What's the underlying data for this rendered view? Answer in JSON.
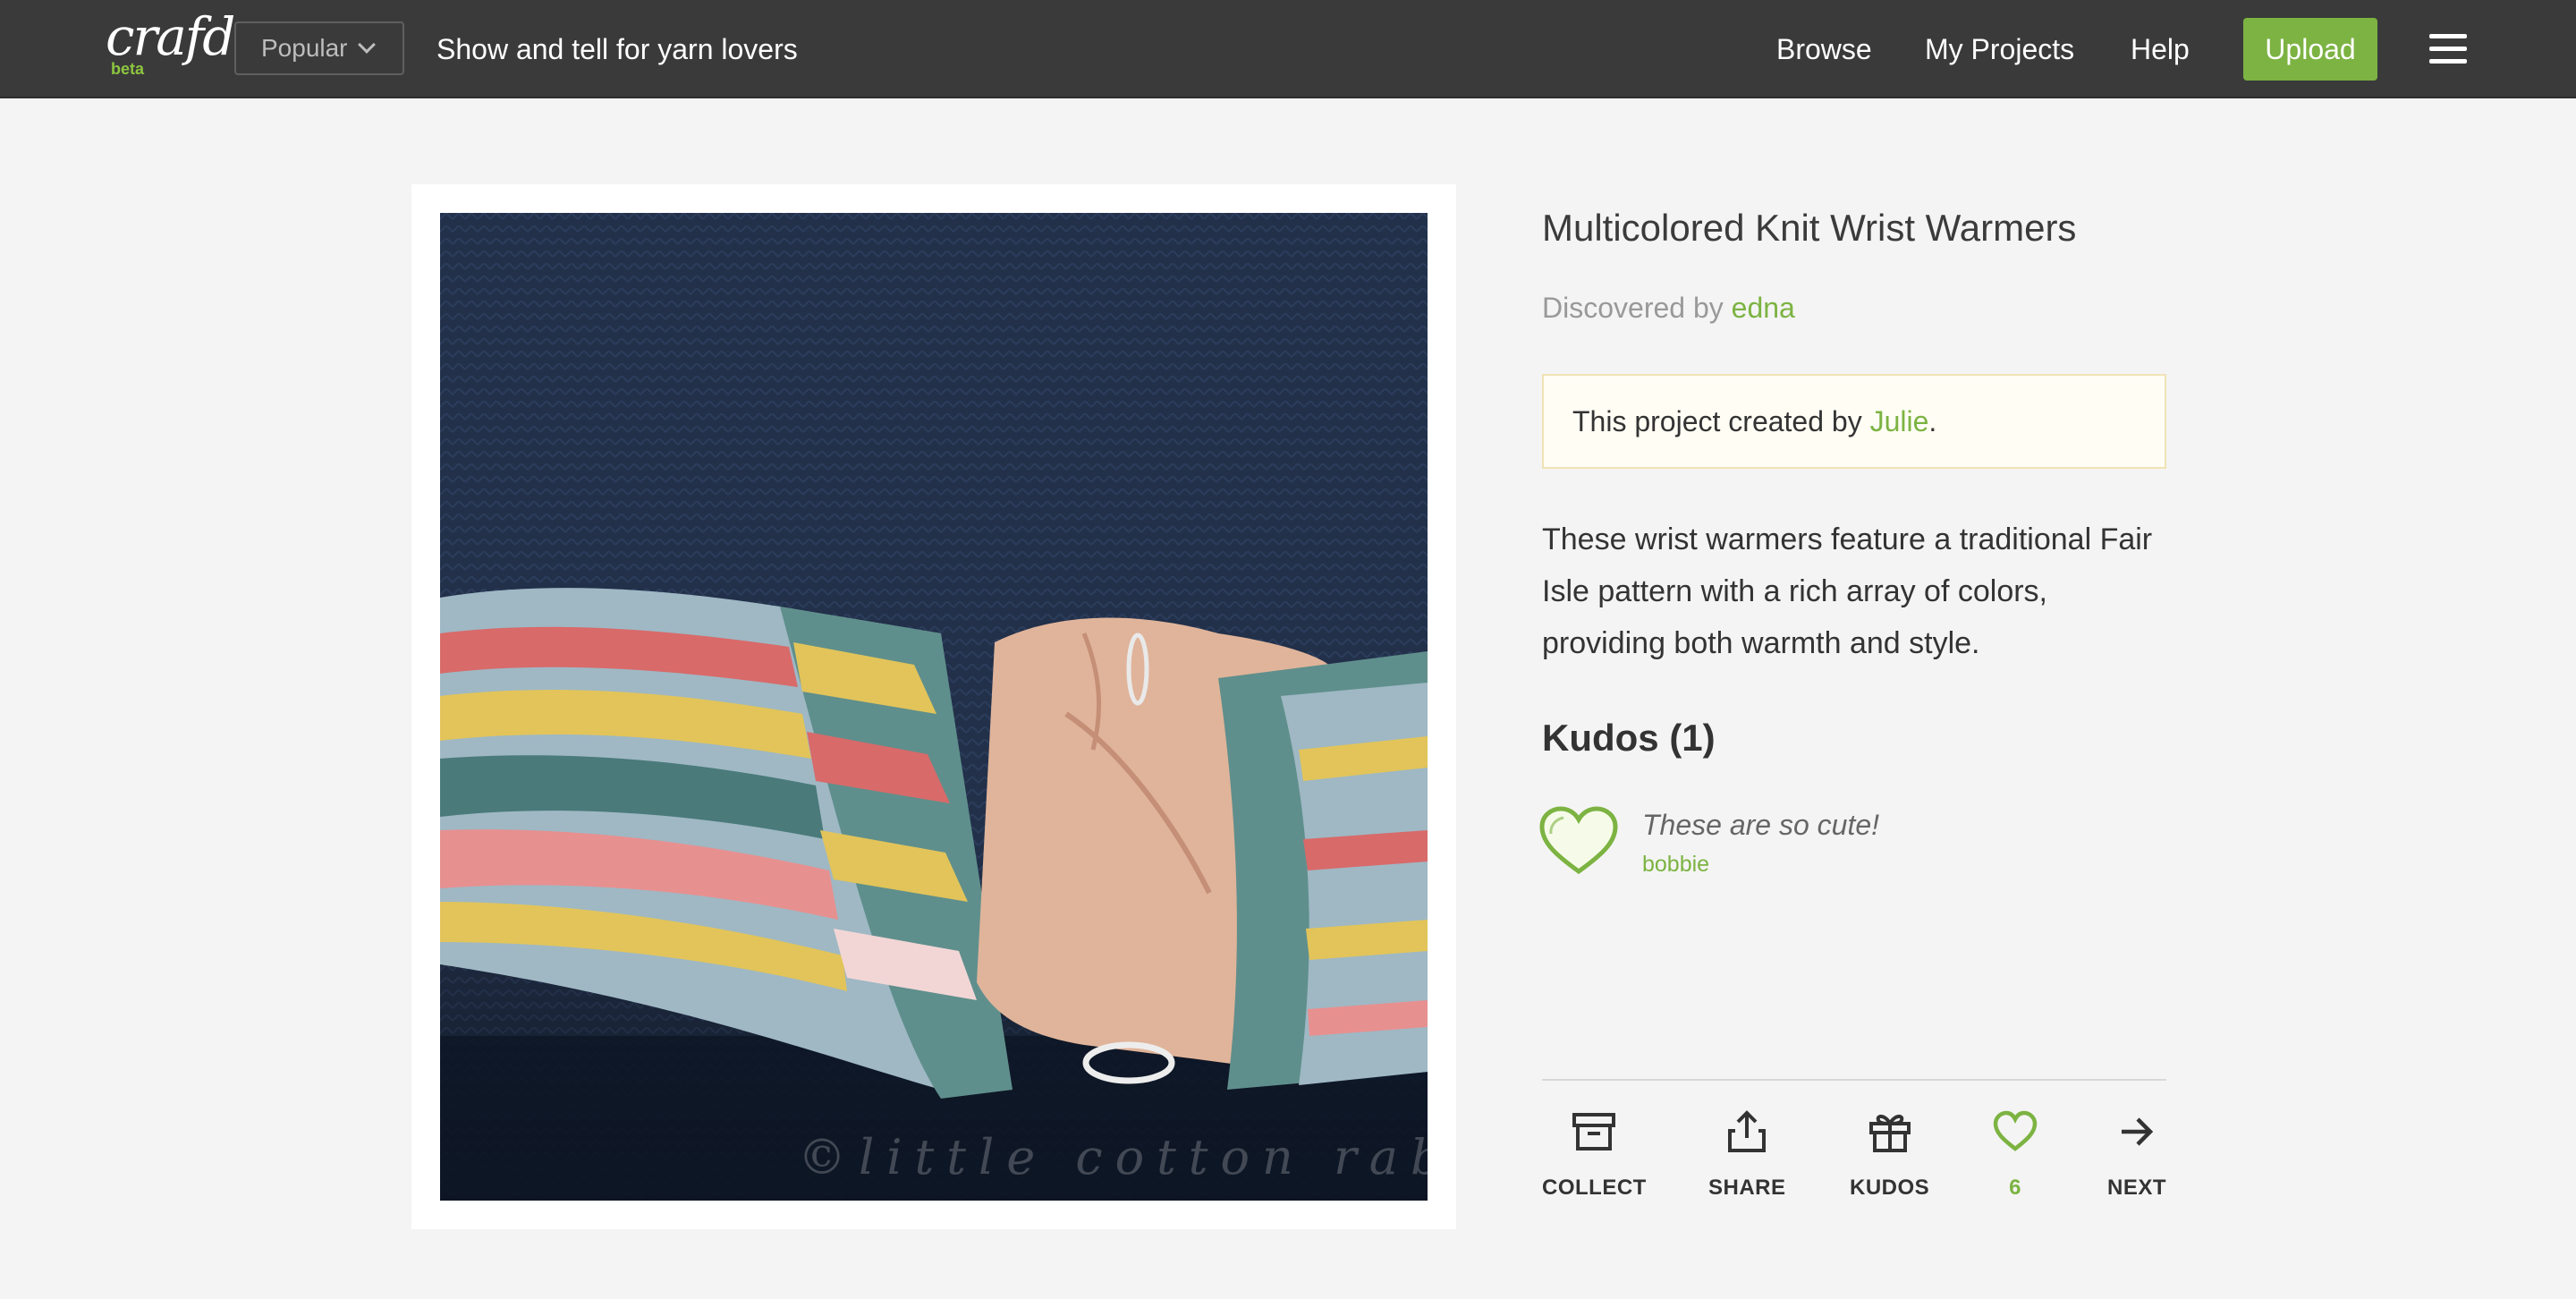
{
  "header": {
    "logo_text": "crafd",
    "logo_badge": "beta",
    "sort_select": {
      "selected": "Popular"
    },
    "tagline": "Show and tell for yarn lovers",
    "nav": [
      {
        "label": "Browse"
      },
      {
        "label": "My Projects"
      },
      {
        "label": "Help"
      }
    ],
    "upload_label": "Upload",
    "menu_icon": "hamburger-icon"
  },
  "photo": {
    "watermark": "©little cotton rabb"
  },
  "project": {
    "title": "Multicolored Knit Wrist Warmers",
    "discovered_prefix": "Discovered by",
    "discovered_user": "edna",
    "created_prefix": "This project created by",
    "created_user": "Julie",
    "created_suffix": ".",
    "description": "These wrist warmers feature a traditional Fair Isle pattern with a rich array of colors, providing both warmth and style."
  },
  "kudos": {
    "title": "Kudos (1)",
    "items": [
      {
        "comment": "These are so cute!",
        "user": "bobbie",
        "icon": "heart-icon"
      }
    ]
  },
  "actions": [
    {
      "label": "COLLECT",
      "icon": "archive-box-icon"
    },
    {
      "label": "SHARE",
      "icon": "share-icon"
    },
    {
      "label": "KUDOS",
      "icon": "gift-icon"
    },
    {
      "label": "6",
      "icon": "heart-icon"
    },
    {
      "label": "NEXT",
      "icon": "arrow-right-icon"
    }
  ],
  "colors": {
    "header_bg": "#3a3a3a",
    "accent_green": "#7cb342",
    "page_bg": "#f4f4f4",
    "notice_bg": "#fffdf4"
  }
}
